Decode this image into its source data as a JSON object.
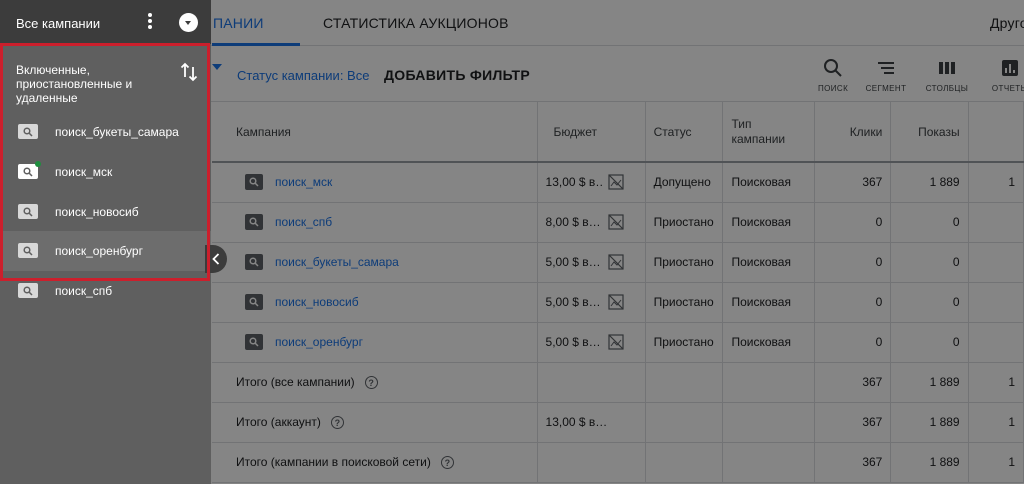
{
  "panel": {
    "title": "Все кампании",
    "filter_label": "Включенные, приостановленные и удаленные",
    "items": [
      {
        "label": "поиск_букеты_самара",
        "selected": false,
        "status_dot": false
      },
      {
        "label": "поиск_мск",
        "selected": false,
        "status_dot": true
      },
      {
        "label": "поиск_новосиб",
        "selected": false,
        "status_dot": false
      },
      {
        "label": "поиск_оренбург",
        "selected": true,
        "status_dot": false
      },
      {
        "label": "поиск_спб",
        "selected": false,
        "status_dot": false
      }
    ]
  },
  "tabs": {
    "active": "ПАНИИ",
    "auction": "СТАТИСТИКА АУКЦИОНОВ",
    "other": "Друго"
  },
  "filterbar": {
    "status": "Статус кампании: Все",
    "add_filter": "ДОБАВИТЬ ФИЛЬТР"
  },
  "toolbar": {
    "search": "ПОИСК",
    "segment": "СЕГМЕНТ",
    "columns": "СТОЛБЦЫ",
    "reports": "ОТЧЕТЫ"
  },
  "table": {
    "headers": {
      "campaign": "Кампания",
      "budget": "Бюджет",
      "status": "Статус",
      "type": "Тип кампании",
      "clicks": "Клики",
      "impressions": "Показы"
    },
    "rows": [
      {
        "name": "поиск_мск",
        "budget": "13,00 $ в…",
        "status": "Допущено",
        "type": "Поисковая",
        "clicks": "367",
        "impressions": "1 889",
        "extra": "1"
      },
      {
        "name": "поиск_спб",
        "budget": "8,00 $ в…",
        "status": "Приостано",
        "type": "Поисковая",
        "clicks": "0",
        "impressions": "0",
        "extra": ""
      },
      {
        "name": "поиск_букеты_самара",
        "budget": "5,00 $ в…",
        "status": "Приостано",
        "type": "Поисковая",
        "clicks": "0",
        "impressions": "0",
        "extra": ""
      },
      {
        "name": "поиск_новосиб",
        "budget": "5,00 $ в…",
        "status": "Приостано",
        "type": "Поисковая",
        "clicks": "0",
        "impressions": "0",
        "extra": ""
      },
      {
        "name": "поиск_оренбург",
        "budget": "5,00 $ в…",
        "status": "Приостано",
        "type": "Поисковая",
        "clicks": "0",
        "impressions": "0",
        "extra": ""
      }
    ],
    "totals": [
      {
        "label": "Итого (все кампании)",
        "budget": "",
        "clicks": "367",
        "impressions": "1 889",
        "extra": "1"
      },
      {
        "label": "Итого (аккаунт)",
        "budget": "13,00 $ в…",
        "clicks": "367",
        "impressions": "1 889",
        "extra": "1"
      },
      {
        "label": "Итого (кампании в поисковой сети)",
        "budget": "",
        "clicks": "367",
        "impressions": "1 889",
        "extra": "1"
      }
    ]
  }
}
